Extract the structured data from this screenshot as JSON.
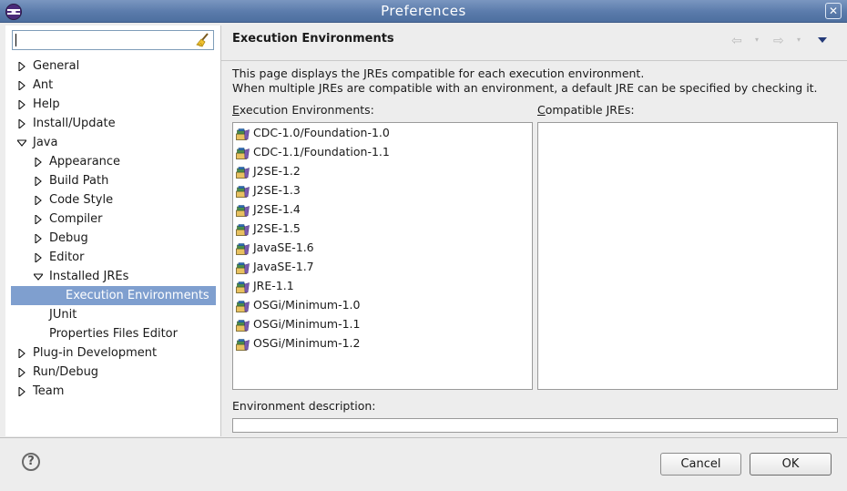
{
  "window": {
    "title": "Preferences",
    "close_glyph": "✕"
  },
  "filter": {
    "value": "",
    "placeholder": ""
  },
  "tree": {
    "items": [
      {
        "label": "General",
        "depth": 0,
        "state": "collapsed"
      },
      {
        "label": "Ant",
        "depth": 0,
        "state": "collapsed"
      },
      {
        "label": "Help",
        "depth": 0,
        "state": "collapsed"
      },
      {
        "label": "Install/Update",
        "depth": 0,
        "state": "collapsed"
      },
      {
        "label": "Java",
        "depth": 0,
        "state": "expanded"
      },
      {
        "label": "Appearance",
        "depth": 1,
        "state": "collapsed"
      },
      {
        "label": "Build Path",
        "depth": 1,
        "state": "collapsed"
      },
      {
        "label": "Code Style",
        "depth": 1,
        "state": "collapsed"
      },
      {
        "label": "Compiler",
        "depth": 1,
        "state": "collapsed"
      },
      {
        "label": "Debug",
        "depth": 1,
        "state": "collapsed"
      },
      {
        "label": "Editor",
        "depth": 1,
        "state": "collapsed"
      },
      {
        "label": "Installed JREs",
        "depth": 1,
        "state": "expanded"
      },
      {
        "label": "Execution Environments",
        "depth": 2,
        "state": "leaf",
        "selected": true
      },
      {
        "label": "JUnit",
        "depth": 1,
        "state": "leaf"
      },
      {
        "label": "Properties Files Editor",
        "depth": 1,
        "state": "leaf"
      },
      {
        "label": "Plug-in Development",
        "depth": 0,
        "state": "collapsed"
      },
      {
        "label": "Run/Debug",
        "depth": 0,
        "state": "collapsed"
      },
      {
        "label": "Team",
        "depth": 0,
        "state": "collapsed"
      }
    ]
  },
  "page": {
    "title": "Execution Environments",
    "description_line1": "This page displays the JREs compatible for each execution environment.",
    "description_line2": "When multiple JREs are compatible with an environment, a default JRE can be specified by checking it.",
    "env_label_mnemonic": "E",
    "env_label_rest": "xecution Environments:",
    "jre_label_mnemonic": "C",
    "jre_label_rest": "ompatible JREs:",
    "env_description_label": "Environment description:",
    "env_description_value": ""
  },
  "environments": [
    "CDC-1.0/Foundation-1.0",
    "CDC-1.1/Foundation-1.1",
    "J2SE-1.2",
    "J2SE-1.3",
    "J2SE-1.4",
    "J2SE-1.5",
    "JavaSE-1.6",
    "JavaSE-1.7",
    "JRE-1.1",
    "OSGi/Minimum-1.0",
    "OSGi/Minimum-1.1",
    "OSGi/Minimum-1.2"
  ],
  "compatible_jres": [],
  "nav": {
    "back_glyph": "⇦",
    "forward_glyph": "⇨",
    "dropdown_glyph": "▾"
  },
  "buttons": {
    "help_glyph": "?",
    "cancel": "Cancel",
    "ok": "OK"
  },
  "icons": {
    "env_item_icon": "jar-library-icon",
    "filter_clear_icon": "broom-icon",
    "tree_collapsed_icon": "triangle-right-icon",
    "tree_expanded_icon": "triangle-down-icon"
  },
  "colors": {
    "titlebar": "#5a7bab",
    "selection": "#7f9fcf",
    "menu_arrow": "#243a78"
  }
}
